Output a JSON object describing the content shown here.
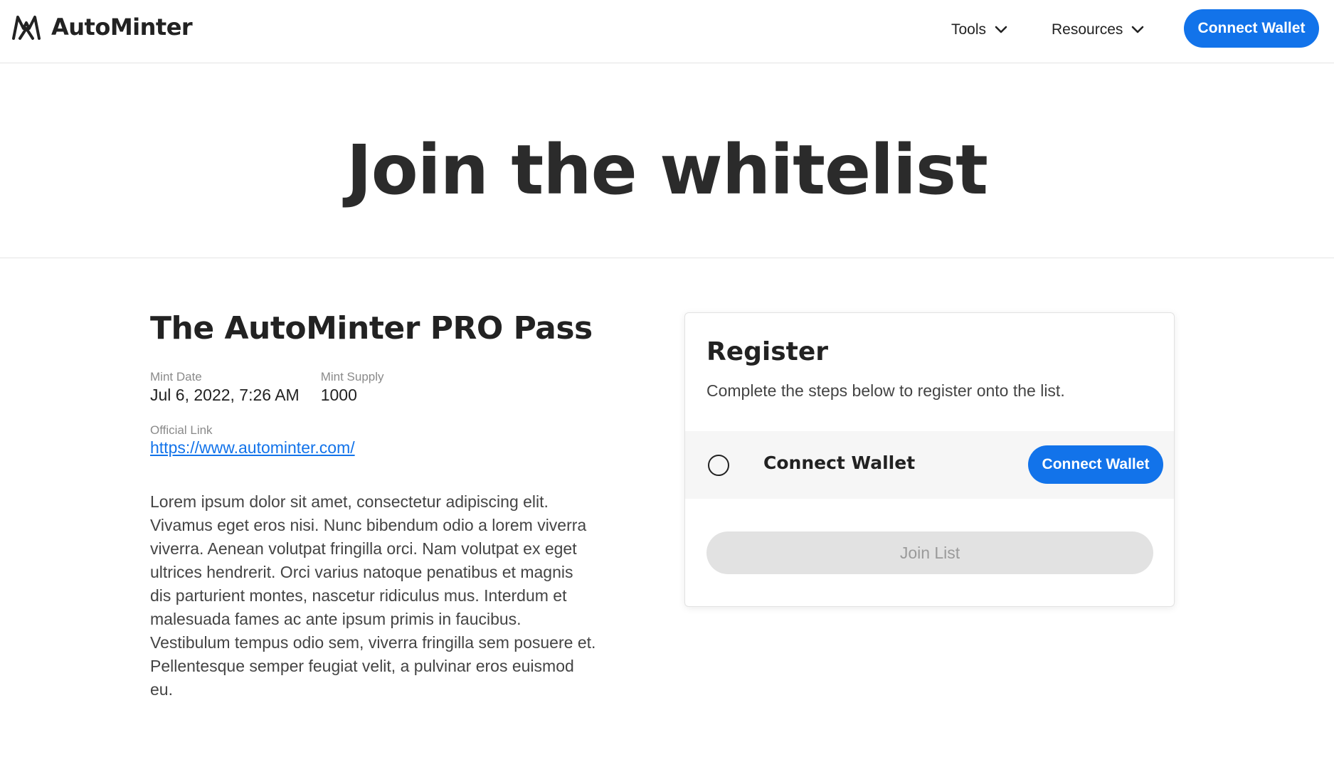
{
  "header": {
    "brand": "AutoMinter",
    "logo_icon": "autominter-logo-icon",
    "nav": [
      {
        "label": "Tools",
        "icon": "chevron-down-icon"
      },
      {
        "label": "Resources",
        "icon": "chevron-down-icon"
      }
    ],
    "connect_label": "Connect Wallet"
  },
  "hero": {
    "title": "Join the whitelist"
  },
  "project": {
    "title": "The AutoMinter PRO Pass",
    "mint_date_label": "Mint Date",
    "mint_date": "Jul 6, 2022, 7:26 AM",
    "mint_supply_label": "Mint Supply",
    "mint_supply": "1000",
    "official_link_label": "Official Link",
    "official_link": "https://www.autominter.com/",
    "description": "Lorem ipsum dolor sit amet, consectetur adipiscing elit. Vivamus eget eros nisi. Nunc bibendum odio a lorem viverra viverra. Aenean volutpat fringilla orci. Nam volutpat ex eget ultrices hendrerit. Orci varius natoque penatibus et magnis dis parturient montes, nascetur ridiculus mus. Interdum et malesuada fames ac ante ipsum primis in faucibus. Vestibulum tempus odio sem, viverra fringilla sem posuere et. Pellentesque semper feugiat velit, a pulvinar eros euismod eu."
  },
  "register": {
    "title": "Register",
    "subtitle": "Complete the steps below to register onto the list.",
    "steps": [
      {
        "label": "Connect Wallet",
        "button": "Connect Wallet",
        "completed": false
      }
    ],
    "join_label": "Join List"
  },
  "colors": {
    "accent": "#1273ea",
    "disabled_bg": "#e2e2e2",
    "disabled_text": "#9a9a9a"
  }
}
